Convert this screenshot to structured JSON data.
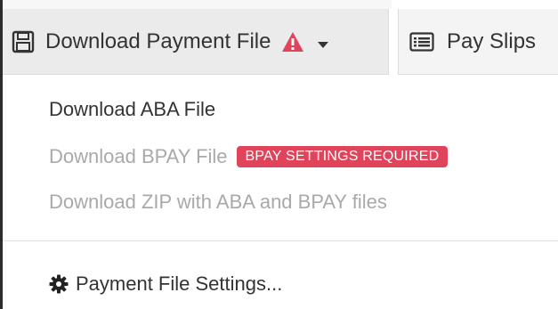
{
  "toolbar": {
    "download_button": {
      "label": "Download Payment File",
      "icon": "save-icon",
      "warning_icon": "warning-icon",
      "caret_icon": "caret-down-icon"
    },
    "payslips_button": {
      "label": "Pay Slips",
      "icon": "list-icon"
    }
  },
  "menu": {
    "items": [
      {
        "label": "Download ABA File",
        "enabled": true
      },
      {
        "label": "Download BPAY File",
        "enabled": false,
        "badge": "BPAY SETTINGS REQUIRED"
      },
      {
        "label": "Download ZIP with ABA and BPAY files",
        "enabled": false
      }
    ],
    "settings": {
      "label": "Payment File Settings...",
      "icon": "gear-icon"
    }
  },
  "colors": {
    "badge_bg": "#e0445a",
    "warning": "#e0445a",
    "text": "#333333",
    "disabled_text": "#a9a9a9"
  }
}
